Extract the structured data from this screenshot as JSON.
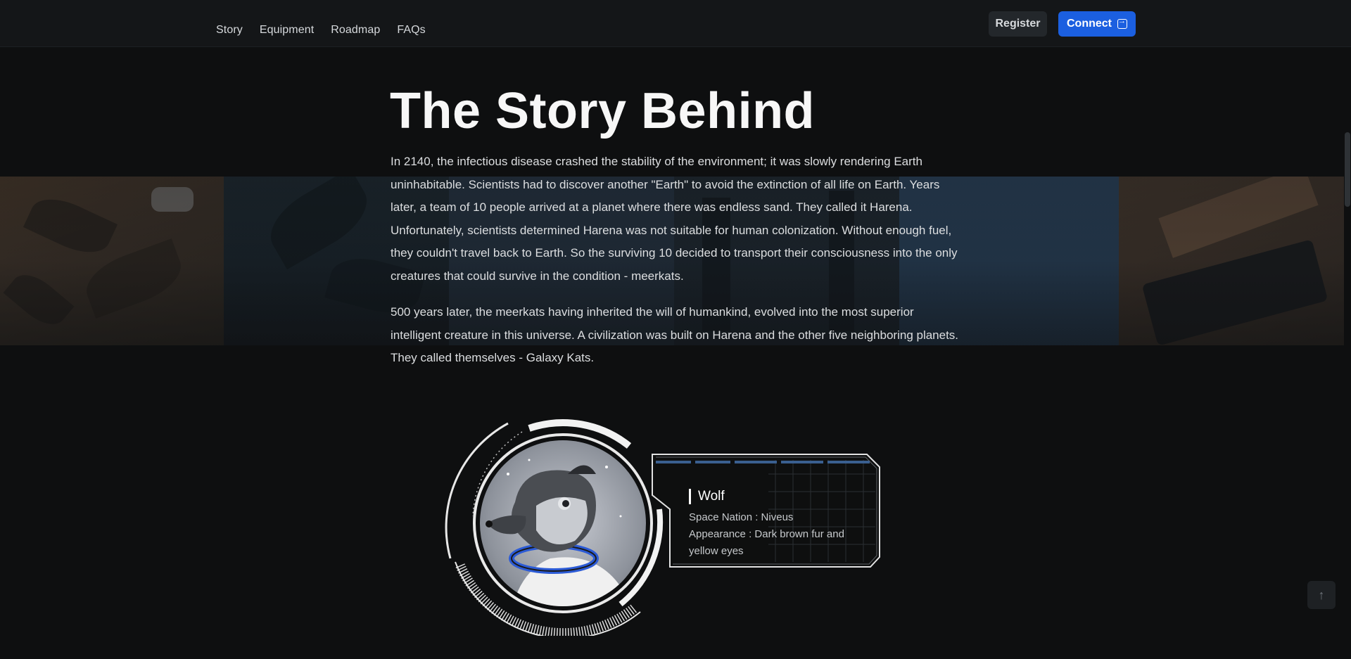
{
  "nav": {
    "links": [
      "Story",
      "Equipment",
      "Roadmap",
      "FAQs"
    ],
    "register_label": "Register",
    "connect_label": "Connect"
  },
  "story": {
    "title": "The Story Behind",
    "paragraph_1": "In 2140, the infectious disease crashed the stability of the environment; it was slowly rendering Earth uninhabitable. Scientists had to discover another \"Earth\" to avoid the extinction of all life on Earth. Years later, a team of 10 people arrived at a planet where there was endless sand. They called it Harena. Unfortunately, scientists determined Harena was not suitable for human colonization. Without enough fuel, they couldn't travel back to Earth. So the surviving 10 decided to transport their consciousness into the only creatures that could survive in the condition - meerkats.",
    "paragraph_2": "500 years later, the meerkats having inherited the will of humankind, evolved into the most superior intelligent creature in this universe. A civilization was built on Harena and the other five neighboring planets. They called themselves - Galaxy Kats."
  },
  "character": {
    "name": "Wolf",
    "nation": "Space Nation : Niveus",
    "appearance": "Appearance : Dark brown fur and yellow eyes"
  },
  "colors": {
    "background": "#0e0f10",
    "navbar": "#141618",
    "accent_blue": "#1b5fe0",
    "suit_blue": "#2c5bd6"
  },
  "icons": {
    "connect": "login-arrow-icon",
    "back_to_top": "arrow-up-icon"
  }
}
